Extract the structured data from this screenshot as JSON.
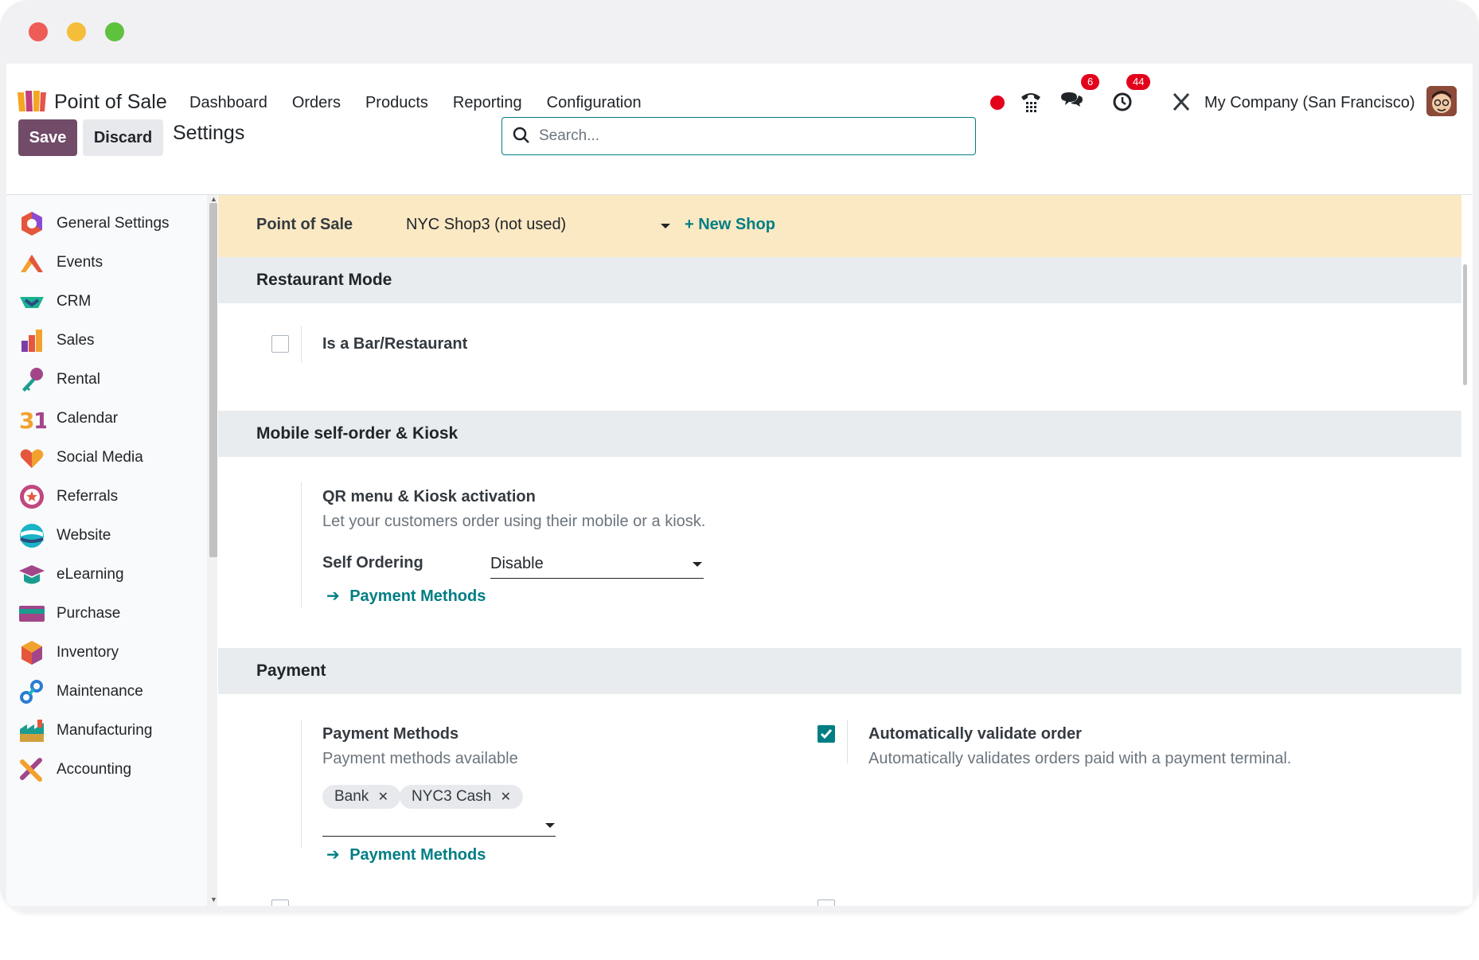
{
  "navbar": {
    "app_name": "Point of Sale",
    "menu": [
      "Dashboard",
      "Orders",
      "Products",
      "Reporting",
      "Configuration"
    ],
    "messages_badge": "6",
    "activities_badge": "44",
    "company": "My Company (San Francisco)"
  },
  "control": {
    "save_label": "Save",
    "discard_label": "Discard",
    "title": "Settings",
    "search_placeholder": "Search..."
  },
  "sidebar": {
    "items": [
      {
        "label": "General Settings",
        "icon": "general-settings-icon"
      },
      {
        "label": "Events",
        "icon": "events-icon"
      },
      {
        "label": "CRM",
        "icon": "crm-icon"
      },
      {
        "label": "Sales",
        "icon": "sales-icon"
      },
      {
        "label": "Rental",
        "icon": "rental-icon"
      },
      {
        "label": "Calendar",
        "icon": "calendar-icon"
      },
      {
        "label": "Social Media",
        "icon": "social-media-icon"
      },
      {
        "label": "Referrals",
        "icon": "referrals-icon"
      },
      {
        "label": "Website",
        "icon": "website-icon"
      },
      {
        "label": "eLearning",
        "icon": "elearning-icon"
      },
      {
        "label": "Purchase",
        "icon": "purchase-icon"
      },
      {
        "label": "Inventory",
        "icon": "inventory-icon"
      },
      {
        "label": "Maintenance",
        "icon": "maintenance-icon"
      },
      {
        "label": "Manufacturing",
        "icon": "manufacturing-icon"
      },
      {
        "label": "Accounting",
        "icon": "accounting-icon"
      }
    ]
  },
  "shop_bar": {
    "label": "Point of Sale",
    "selected_shop": "NYC Shop3 (not used)",
    "new_shop_label": "+ New Shop"
  },
  "restaurant": {
    "heading": "Restaurant Mode",
    "bar_label": "Is a Bar/Restaurant",
    "bar_checked": false
  },
  "kiosk": {
    "heading": "Mobile self-order & Kiosk",
    "title": "QR menu & Kiosk activation",
    "desc": "Let your customers order using their mobile or a kiosk.",
    "self_ordering_label": "Self Ordering",
    "self_ordering_value": "Disable",
    "link": "Payment Methods"
  },
  "payment": {
    "heading": "Payment",
    "methods_title": "Payment Methods",
    "methods_desc": "Payment methods available",
    "tags": [
      "Bank",
      "NYC3 Cash"
    ],
    "methods_link": "Payment Methods",
    "auto_validate_title": "Automatically validate order",
    "auto_validate_desc": "Automatically validates orders paid with a payment terminal.",
    "auto_validate_checked": true
  },
  "colors": {
    "brand": "#714b67",
    "accent": "#017e84",
    "shop_bar": "#fbe9c4",
    "badge": "#e3001b"
  }
}
